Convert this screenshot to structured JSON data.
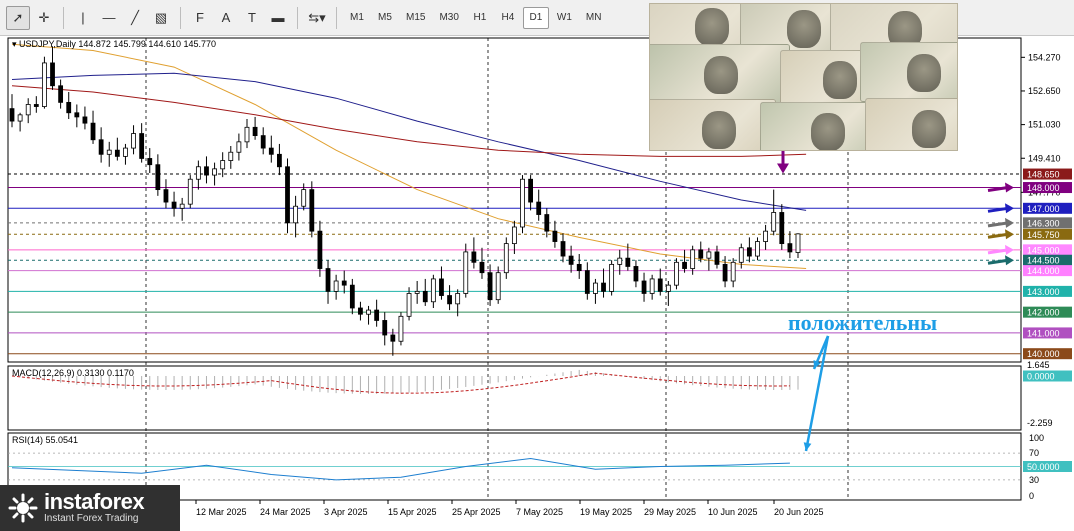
{
  "toolbar": {
    "tools": [
      {
        "name": "cursor-tool",
        "glyph": "➚"
      },
      {
        "name": "crosshair-tool",
        "glyph": "✛"
      },
      {
        "name": "vertical-line-tool",
        "glyph": "|"
      },
      {
        "name": "horizontal-line-tool",
        "glyph": "—"
      },
      {
        "name": "trendline-tool",
        "glyph": "╱"
      },
      {
        "name": "channel-tool",
        "glyph": "▧"
      },
      {
        "name": "fibonacci-tool",
        "glyph": "F"
      },
      {
        "name": "text-tool",
        "glyph": "A"
      },
      {
        "name": "label-tool",
        "glyph": "T"
      },
      {
        "name": "rectangle-tool",
        "glyph": "▬"
      },
      {
        "name": "arrows-tool",
        "glyph": "⇆▾"
      }
    ],
    "timeframes": [
      "M1",
      "M5",
      "M15",
      "M30",
      "H1",
      "H4",
      "D1",
      "W1",
      "MN"
    ],
    "active_timeframe": "D1"
  },
  "chart_header": {
    "symbol_line": "USDJPY,Daily  144.872 145.799 144.610 145.770"
  },
  "macd": {
    "label": "MACD(12,26,9) 0.3130 0.1170",
    "top_value": "1.645",
    "zero_value": "0.0000",
    "bottom_value": "-2.259"
  },
  "rsi": {
    "label": "RSI(14) 55.0541",
    "levels": [
      "100",
      "70",
      "50.0000",
      "30",
      "0"
    ]
  },
  "annotation_text": "положительны",
  "logo": {
    "brand": "instaforex",
    "tagline": "Instant Forex Trading"
  },
  "price_axis": {
    "ticks": [
      "154.270",
      "152.650",
      "151.030",
      "149.410",
      "147.770"
    ],
    "levels": [
      {
        "value": "148.650",
        "price": 148.65,
        "bg": "#8b1a1a",
        "fg": "#ffffff",
        "line": "#000000",
        "dash": "3,3"
      },
      {
        "value": "148.000",
        "price": 148.0,
        "bg": "#800080",
        "fg": "#ffffff",
        "line": "#800080",
        "dash": ""
      },
      {
        "value": "147.000",
        "price": 147.0,
        "bg": "#1f1fbf",
        "fg": "#ffffff",
        "line": "#1f1fbf",
        "dash": ""
      },
      {
        "value": "146.300",
        "price": 146.3,
        "bg": "#707070",
        "fg": "#ffffff",
        "line": "#707070",
        "dash": "3,3"
      },
      {
        "value": "145.750",
        "price": 145.75,
        "bg": "#8a6a10",
        "fg": "#ffffff",
        "line": "#8a6a10",
        "dash": "3,3"
      },
      {
        "value": "145.000",
        "price": 145.0,
        "bg": "#ff88ff",
        "fg": "#ffffff",
        "line": "#ff66cc",
        "dash": ""
      },
      {
        "value": "144.500",
        "price": 144.5,
        "bg": "#1a6b6b",
        "fg": "#ffffff",
        "line": "#1a6b6b",
        "dash": "3,3"
      },
      {
        "value": "144.000",
        "price": 144.0,
        "bg": "#ff80ff",
        "fg": "#ffffff",
        "line": "#d070d0",
        "dash": ""
      },
      {
        "value": "143.000",
        "price": 143.0,
        "bg": "#20b2aa",
        "fg": "#ffffff",
        "line": "#20b2aa",
        "dash": ""
      },
      {
        "value": "142.000",
        "price": 142.0,
        "bg": "#2e8b57",
        "fg": "#ffffff",
        "line": "#2e8b57",
        "dash": ""
      },
      {
        "value": "141.000",
        "price": 141.0,
        "bg": "#b050c0",
        "fg": "#ffffff",
        "line": "#b050c0",
        "dash": ""
      },
      {
        "value": "140.000",
        "price": 140.0,
        "bg": "#8b4a1a",
        "fg": "#ffffff",
        "line": "#8b4a1a",
        "dash": ""
      }
    ]
  },
  "time_axis": {
    "labels": [
      "12 Mar 2025",
      "24 Mar 2025",
      "3 Apr 2025",
      "15 Apr 2025",
      "25 Apr 2025",
      "7 May 2025",
      "19 May 2025",
      "29 May 2025",
      "10 Jun 2025",
      "20 Jun 2025"
    ]
  },
  "chart_data": {
    "type": "candlestick",
    "title": "USDJPY,Daily",
    "ylim": [
      139.6,
      155.2
    ],
    "ohlc": [
      [
        151.8,
        152.5,
        150.9,
        151.2
      ],
      [
        151.2,
        151.6,
        150.7,
        151.5
      ],
      [
        151.5,
        152.3,
        151.1,
        152.0
      ],
      [
        152.0,
        152.4,
        151.6,
        151.9
      ],
      [
        151.9,
        154.3,
        151.8,
        154.0
      ],
      [
        154.0,
        154.8,
        152.7,
        152.9
      ],
      [
        152.9,
        153.2,
        151.8,
        152.1
      ],
      [
        152.1,
        152.6,
        151.3,
        151.6
      ],
      [
        151.6,
        152.0,
        150.9,
        151.4
      ],
      [
        151.4,
        151.9,
        150.8,
        151.1
      ],
      [
        151.1,
        151.7,
        150.1,
        150.3
      ],
      [
        150.3,
        150.9,
        149.2,
        149.6
      ],
      [
        149.6,
        150.2,
        149.0,
        149.8
      ],
      [
        149.8,
        150.4,
        149.3,
        149.5
      ],
      [
        149.5,
        150.1,
        149.1,
        149.9
      ],
      [
        149.9,
        151.0,
        149.6,
        150.6
      ],
      [
        150.6,
        151.1,
        149.2,
        149.4
      ],
      [
        149.4,
        149.9,
        148.7,
        149.1
      ],
      [
        149.1,
        149.6,
        147.6,
        147.9
      ],
      [
        147.9,
        148.4,
        147.0,
        147.3
      ],
      [
        147.3,
        147.8,
        146.6,
        147.0
      ],
      [
        147.0,
        147.5,
        146.4,
        147.2
      ],
      [
        147.2,
        148.6,
        147.0,
        148.4
      ],
      [
        148.4,
        149.3,
        147.9,
        149.0
      ],
      [
        149.0,
        149.5,
        148.2,
        148.6
      ],
      [
        148.6,
        149.2,
        148.1,
        148.9
      ],
      [
        148.9,
        149.7,
        148.5,
        149.3
      ],
      [
        149.3,
        150.0,
        148.9,
        149.7
      ],
      [
        149.7,
        150.6,
        149.3,
        150.2
      ],
      [
        150.2,
        151.3,
        149.9,
        150.9
      ],
      [
        150.9,
        151.4,
        150.3,
        150.5
      ],
      [
        150.5,
        150.9,
        149.6,
        149.9
      ],
      [
        149.9,
        150.5,
        149.2,
        149.6
      ],
      [
        149.6,
        150.1,
        148.6,
        149.0
      ],
      [
        149.0,
        149.4,
        145.8,
        146.3
      ],
      [
        146.3,
        147.6,
        145.6,
        147.1
      ],
      [
        147.1,
        148.2,
        146.9,
        147.9
      ],
      [
        147.9,
        148.3,
        145.6,
        145.9
      ],
      [
        145.9,
        146.4,
        143.7,
        144.1
      ],
      [
        144.1,
        144.5,
        142.4,
        143.0
      ],
      [
        143.0,
        143.8,
        142.6,
        143.5
      ],
      [
        143.5,
        144.0,
        142.9,
        143.3
      ],
      [
        143.3,
        143.6,
        141.9,
        142.2
      ],
      [
        142.2,
        142.5,
        141.6,
        141.9
      ],
      [
        141.9,
        142.3,
        141.4,
        142.1
      ],
      [
        142.1,
        142.6,
        141.3,
        141.6
      ],
      [
        141.6,
        142.0,
        140.4,
        140.9
      ],
      [
        140.9,
        141.2,
        139.9,
        140.6
      ],
      [
        140.6,
        142.0,
        140.4,
        141.8
      ],
      [
        141.8,
        143.2,
        141.6,
        142.9
      ],
      [
        142.9,
        143.5,
        142.4,
        143.0
      ],
      [
        143.0,
        143.6,
        142.3,
        142.5
      ],
      [
        142.5,
        143.8,
        142.2,
        143.6
      ],
      [
        143.6,
        144.2,
        142.6,
        142.8
      ],
      [
        142.8,
        143.3,
        142.1,
        142.4
      ],
      [
        142.4,
        143.1,
        141.8,
        142.9
      ],
      [
        142.9,
        145.3,
        142.7,
        144.9
      ],
      [
        144.9,
        145.6,
        144.1,
        144.4
      ],
      [
        144.4,
        145.1,
        143.6,
        143.9
      ],
      [
        143.9,
        144.3,
        142.3,
        142.6
      ],
      [
        142.6,
        144.2,
        142.4,
        143.9
      ],
      [
        143.9,
        145.6,
        143.6,
        145.3
      ],
      [
        145.3,
        146.4,
        144.8,
        146.1
      ],
      [
        146.1,
        148.6,
        145.8,
        148.4
      ],
      [
        148.4,
        148.6,
        146.9,
        147.3
      ],
      [
        147.3,
        147.9,
        146.4,
        146.7
      ],
      [
        146.7,
        147.0,
        145.6,
        145.9
      ],
      [
        145.9,
        146.4,
        145.1,
        145.4
      ],
      [
        145.4,
        145.8,
        144.4,
        144.7
      ],
      [
        144.7,
        145.2,
        143.9,
        144.3
      ],
      [
        144.3,
        144.8,
        143.6,
        144.0
      ],
      [
        144.0,
        144.4,
        142.6,
        142.9
      ],
      [
        142.9,
        143.6,
        142.4,
        143.4
      ],
      [
        143.4,
        144.1,
        142.7,
        143.0
      ],
      [
        143.0,
        144.5,
        142.8,
        144.3
      ],
      [
        144.3,
        145.0,
        143.8,
        144.6
      ],
      [
        144.6,
        145.3,
        144.0,
        144.2
      ],
      [
        144.2,
        144.5,
        143.2,
        143.5
      ],
      [
        143.5,
        143.9,
        142.5,
        142.9
      ],
      [
        142.9,
        143.8,
        142.6,
        143.6
      ],
      [
        143.6,
        144.1,
        142.8,
        143.0
      ],
      [
        143.0,
        143.5,
        142.3,
        143.3
      ],
      [
        143.3,
        144.6,
        143.1,
        144.4
      ],
      [
        144.4,
        145.0,
        143.9,
        144.1
      ],
      [
        144.1,
        145.2,
        143.8,
        145.0
      ],
      [
        145.0,
        145.4,
        144.4,
        144.6
      ],
      [
        144.6,
        145.1,
        144.0,
        144.9
      ],
      [
        144.9,
        145.2,
        144.1,
        144.3
      ],
      [
        144.3,
        144.7,
        143.2,
        143.5
      ],
      [
        143.5,
        144.6,
        143.2,
        144.4
      ],
      [
        144.4,
        145.3,
        144.1,
        145.1
      ],
      [
        145.1,
        145.6,
        144.4,
        144.7
      ],
      [
        144.7,
        145.6,
        144.5,
        145.4
      ],
      [
        145.4,
        146.2,
        145.0,
        145.9
      ],
      [
        145.9,
        147.9,
        145.7,
        146.8
      ],
      [
        146.8,
        147.2,
        145.0,
        145.3
      ],
      [
        145.3,
        145.9,
        144.6,
        144.9
      ],
      [
        144.872,
        145.799,
        144.61,
        145.77
      ]
    ],
    "ma_orange": [
      [
        0,
        154.9
      ],
      [
        10,
        154.6
      ],
      [
        20,
        153.8
      ],
      [
        30,
        152.0
      ],
      [
        40,
        149.8
      ],
      [
        50,
        147.9
      ],
      [
        60,
        146.5
      ],
      [
        70,
        145.6
      ],
      [
        80,
        144.8
      ],
      [
        90,
        144.3
      ],
      [
        98,
        144.1
      ]
    ],
    "ma_blue": [
      [
        0,
        153.2
      ],
      [
        10,
        153.4
      ],
      [
        20,
        153.5
      ],
      [
        30,
        153.1
      ],
      [
        40,
        152.3
      ],
      [
        50,
        151.2
      ],
      [
        60,
        150.2
      ],
      [
        70,
        149.3
      ],
      [
        80,
        148.3
      ],
      [
        90,
        147.4
      ],
      [
        98,
        146.9
      ]
    ],
    "ma_red": [
      [
        0,
        152.9
      ],
      [
        10,
        152.6
      ],
      [
        20,
        152.1
      ],
      [
        30,
        151.5
      ],
      [
        40,
        150.8
      ],
      [
        50,
        150.2
      ],
      [
        60,
        149.8
      ],
      [
        70,
        149.6
      ],
      [
        80,
        149.5
      ],
      [
        90,
        149.5
      ],
      [
        98,
        149.6
      ]
    ],
    "macd_histogram_note": "grey histogram bars",
    "rsi_line": [
      [
        0,
        48
      ],
      [
        8,
        44
      ],
      [
        16,
        40
      ],
      [
        24,
        52
      ],
      [
        32,
        38
      ],
      [
        40,
        30
      ],
      [
        48,
        34
      ],
      [
        56,
        50
      ],
      [
        64,
        62
      ],
      [
        72,
        46
      ],
      [
        80,
        50
      ],
      [
        88,
        52
      ],
      [
        96,
        55
      ]
    ]
  }
}
